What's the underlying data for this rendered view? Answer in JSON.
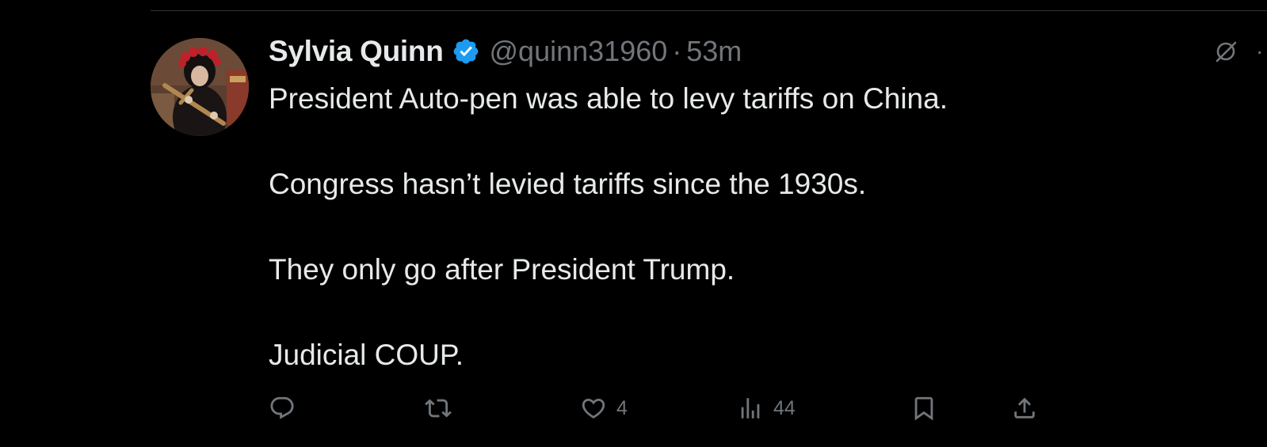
{
  "post": {
    "display_name": "Sylvia Quinn",
    "handle": "@quinn31960",
    "separator": "·",
    "time": "53m",
    "verified_color": "#1d9bf0",
    "text_lines": [
      "President Auto-pen was able to levy tariffs on China.",
      "Congress hasn’t levied tariffs since the 1930s.",
      "They only go after President Trump.",
      "Judicial COUP."
    ]
  },
  "actions": {
    "reply": {
      "icon": "reply-icon"
    },
    "repost": {
      "icon": "repost-icon"
    },
    "like": {
      "icon": "heart-icon",
      "count": "4"
    },
    "views": {
      "icon": "views-icon",
      "count": "44"
    },
    "bookmark": {
      "icon": "bookmark-icon"
    },
    "share": {
      "icon": "share-icon"
    }
  },
  "top_right": {
    "grok_icon": "grok-icon",
    "more_icon": "more-dots-icon",
    "more_label": "·"
  },
  "colors": {
    "background": "#000000",
    "text": "#e7e9ea",
    "secondary": "#71767b",
    "divider": "#2f3336"
  }
}
